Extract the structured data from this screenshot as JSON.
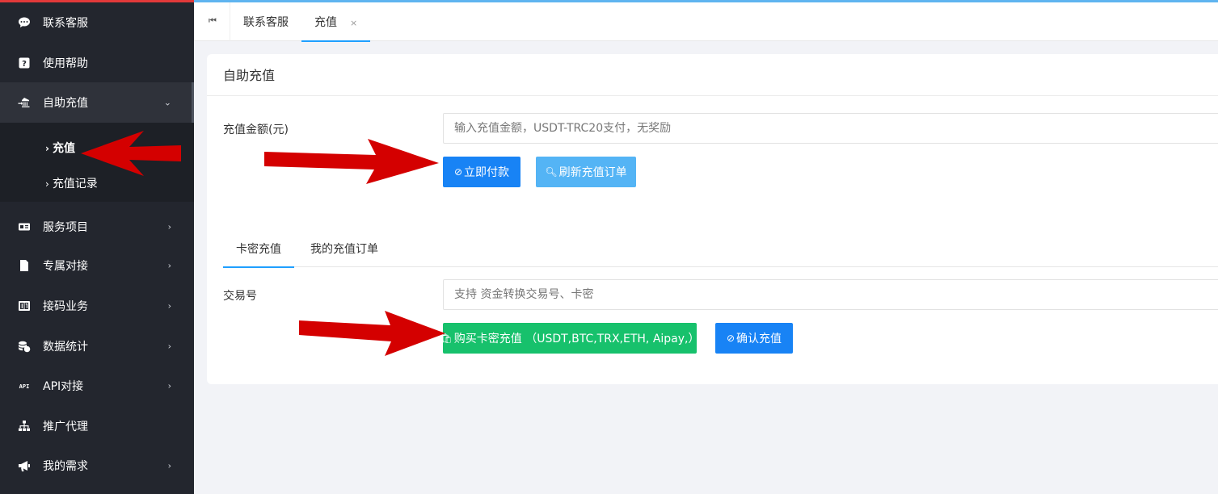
{
  "sidebar": {
    "items": [
      {
        "label": "联系客服",
        "icon": "chat-bubble-icon",
        "has_children": false
      },
      {
        "label": "使用帮助",
        "icon": "question-box-icon",
        "has_children": false
      },
      {
        "label": "自助充值",
        "icon": "bank-icon",
        "has_children": true,
        "open": true
      },
      {
        "label": "服务项目",
        "icon": "id-card-icon",
        "has_children": true
      },
      {
        "label": "专属对接",
        "icon": "document-icon",
        "has_children": true
      },
      {
        "label": "接码业务",
        "icon": "numeric-box-icon",
        "has_children": true
      },
      {
        "label": "数据统计",
        "icon": "coins-icon",
        "has_children": true
      },
      {
        "label": "API对接",
        "icon": "api-text-icon",
        "has_children": true
      },
      {
        "label": "推广代理",
        "icon": "sitemap-icon",
        "has_children": false
      },
      {
        "label": "我的需求",
        "icon": "megaphone-icon",
        "has_children": true
      }
    ],
    "sub_items": [
      {
        "label": "充值",
        "active": true
      },
      {
        "label": "充值记录",
        "active": false
      }
    ]
  },
  "topbar": {
    "tabs": [
      {
        "label": "联系客服",
        "active": false
      },
      {
        "label": "充值",
        "active": true,
        "close": "×"
      }
    ]
  },
  "card": {
    "title": "自助充值",
    "amount_label": "充值金额(元)",
    "amount_placeholder": "输入充值金额，USDT-TRC20支付，无奖励",
    "pay_button": "立即付款",
    "refresh_button": "刷新充值订单",
    "tabs": [
      {
        "label": "卡密充值",
        "active": true
      },
      {
        "label": "我的充值订单",
        "active": false
      }
    ],
    "txn_label": "交易号",
    "txn_placeholder": "支持 资金转换交易号、卡密",
    "buy_button": "购买卡密充值 （USDT,BTC,TRX,ETH, Aipay,）",
    "confirm_button": "确认充值"
  },
  "colors": {
    "sidebar_bg": "#23262e",
    "primary_blue": "#1883f5",
    "light_blue": "#54b4f5",
    "green": "#17c16c",
    "arrow_red": "#d40000"
  }
}
